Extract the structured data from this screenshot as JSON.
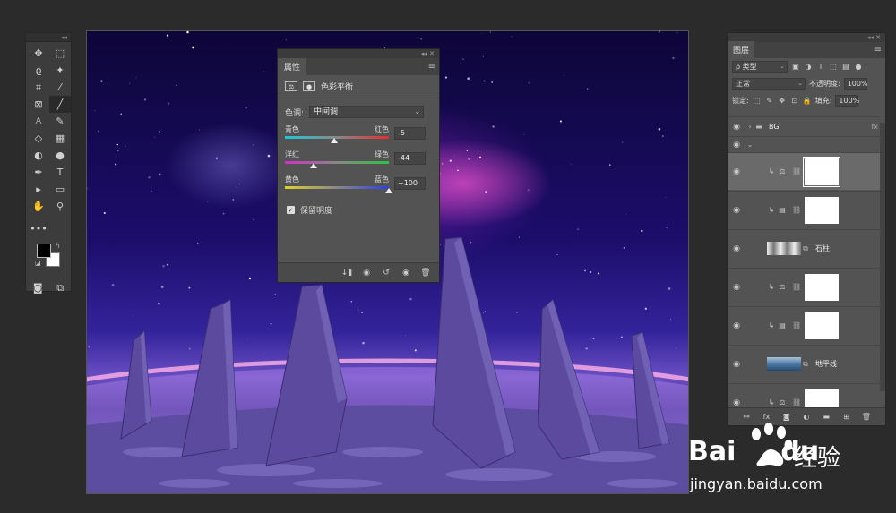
{
  "toolbar": {
    "collapse": "◂◂",
    "tools": [
      {
        "name": "move-tool",
        "glyph": "✥"
      },
      {
        "name": "marquee-tool",
        "glyph": "⬚"
      },
      {
        "name": "lasso-tool",
        "glyph": "ϱ"
      },
      {
        "name": "magic-wand-tool",
        "glyph": "✦"
      },
      {
        "name": "crop-tool",
        "glyph": "⌗"
      },
      {
        "name": "eyedropper-tool",
        "glyph": "⁄"
      },
      {
        "name": "frame-tool",
        "glyph": "⊠"
      },
      {
        "name": "brush-tool",
        "glyph": "╱"
      },
      {
        "name": "stamp-tool",
        "glyph": "♙"
      },
      {
        "name": "healing-tool",
        "glyph": "✎"
      },
      {
        "name": "eraser-tool",
        "glyph": "◇"
      },
      {
        "name": "gradient-tool",
        "glyph": "▦"
      },
      {
        "name": "blur-tool",
        "glyph": "◐"
      },
      {
        "name": "dodge-tool",
        "glyph": "●"
      },
      {
        "name": "pen-tool",
        "glyph": "✒"
      },
      {
        "name": "type-tool",
        "glyph": "T"
      },
      {
        "name": "path-select-tool",
        "glyph": "▸"
      },
      {
        "name": "shape-tool",
        "glyph": "▭"
      },
      {
        "name": "hand-tool",
        "glyph": "✋"
      },
      {
        "name": "zoom-tool",
        "glyph": "⚲"
      }
    ],
    "more": "•••",
    "colors": {
      "foreground": "#000000",
      "background": "#ffffff"
    }
  },
  "properties": {
    "collapse": "◂◂",
    "close": "✕",
    "tab": "属性",
    "menu": "≡",
    "adjustment_title": "色彩平衡",
    "tone_label": "色调:",
    "tone_value": "中间调",
    "sliders": [
      {
        "left": "青色",
        "right": "红色",
        "value": "-5",
        "fraction": 0.475,
        "gradient": "linear-gradient(90deg,#1ec8d8,#888 50%,#e03030)"
      },
      {
        "left": "洋红",
        "right": "绿色",
        "value": "-44",
        "fraction": 0.28,
        "gradient": "linear-gradient(90deg,#d030c8,#888 50%,#30c040)"
      },
      {
        "left": "黄色",
        "right": "蓝色",
        "value": "+100",
        "fraction": 1.0,
        "gradient": "linear-gradient(90deg,#e0d030,#888 50%,#3040e0)"
      }
    ],
    "preserve_label": "保留明度"
  },
  "layers": {
    "collapse": "◂◂",
    "close": "✕",
    "tab": "图层",
    "menu": "≡",
    "filter_kind": "ρ 类型",
    "blend_mode": "正常",
    "opacity_label": "不透明度:",
    "opacity_value": "100%",
    "lock_label": "锁定:",
    "fill_label": "填充:",
    "fill_value": "100%",
    "group_name": "BG",
    "fx_label": "fx",
    "items": [
      {
        "type": "balance",
        "name": "",
        "thumb": "white",
        "selected": true
      },
      {
        "type": "levels",
        "name": "",
        "thumb": "white",
        "selected": false
      },
      {
        "type": "image",
        "name": "石柱",
        "thumb": "stone",
        "selected": false
      },
      {
        "type": "balance",
        "name": "",
        "thumb": "white",
        "selected": false
      },
      {
        "type": "levels",
        "name": "",
        "thumb": "white",
        "selected": false
      },
      {
        "type": "image",
        "name": "地平线",
        "thumb": "horizon",
        "selected": false
      },
      {
        "type": "balance",
        "name": "",
        "thumb": "white",
        "selected": false
      }
    ]
  },
  "watermark": {
    "brand": "Bai",
    "brand2": "du",
    "cn": "经验",
    "url": "jingyan.baidu.com"
  }
}
